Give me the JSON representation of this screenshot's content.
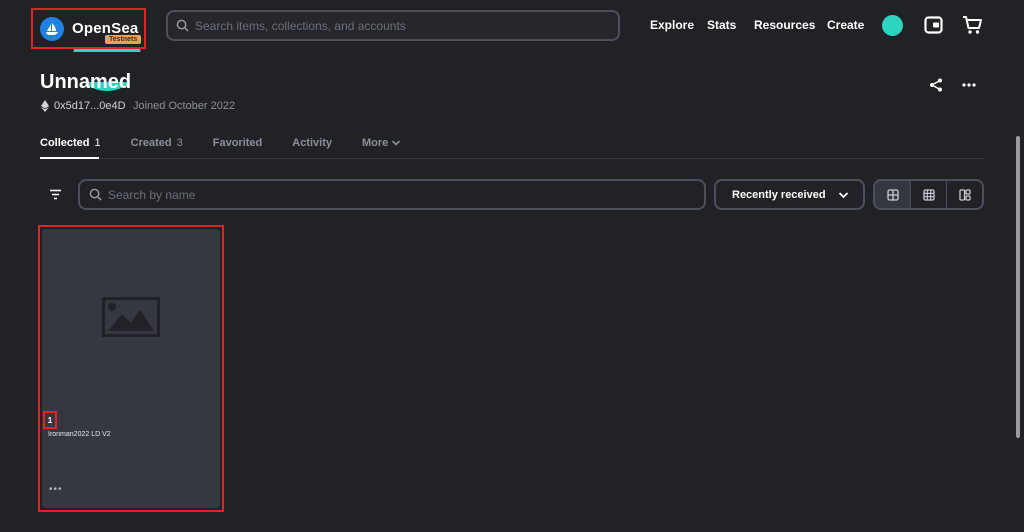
{
  "header": {
    "logo_text": "OpenSea",
    "badge": "Testnets",
    "search_placeholder": "Search items, collections, and accounts",
    "nav": [
      "Explore",
      "Stats",
      "Resources",
      "Create"
    ],
    "icons": [
      "opensea-boat-icon",
      "search-icon",
      "avatar",
      "wallet-icon",
      "cart-icon"
    ]
  },
  "profile": {
    "name": "Unnamed",
    "address": "0x5d17...0e4D",
    "joined": "Joined October 2022",
    "icons": [
      "ethereum-icon",
      "share-icon",
      "more-dots-icon"
    ]
  },
  "tabs": [
    {
      "label": "Collected",
      "count": "1",
      "active": true
    },
    {
      "label": "Created",
      "count": "3",
      "active": false
    },
    {
      "label": "Favorited",
      "count": "",
      "active": false
    },
    {
      "label": "Activity",
      "count": "",
      "active": false
    },
    {
      "label": "More",
      "count": "",
      "active": false
    }
  ],
  "filters": {
    "search_placeholder": "Search by name",
    "sort_value": "Recently received",
    "view_modes": [
      "large-grid-icon",
      "small-grid-icon",
      "compact-layout-icon"
    ]
  },
  "items": [
    {
      "number": "1",
      "name": "Ironman2022 LD V2",
      "more": "•••"
    }
  ],
  "colors": {
    "background": "#202225",
    "card": "#353840",
    "accent_blue": "#2081e2",
    "avatar": "#2dd4bf",
    "badge": "#f1a153",
    "highlight_red": "#e02424"
  }
}
